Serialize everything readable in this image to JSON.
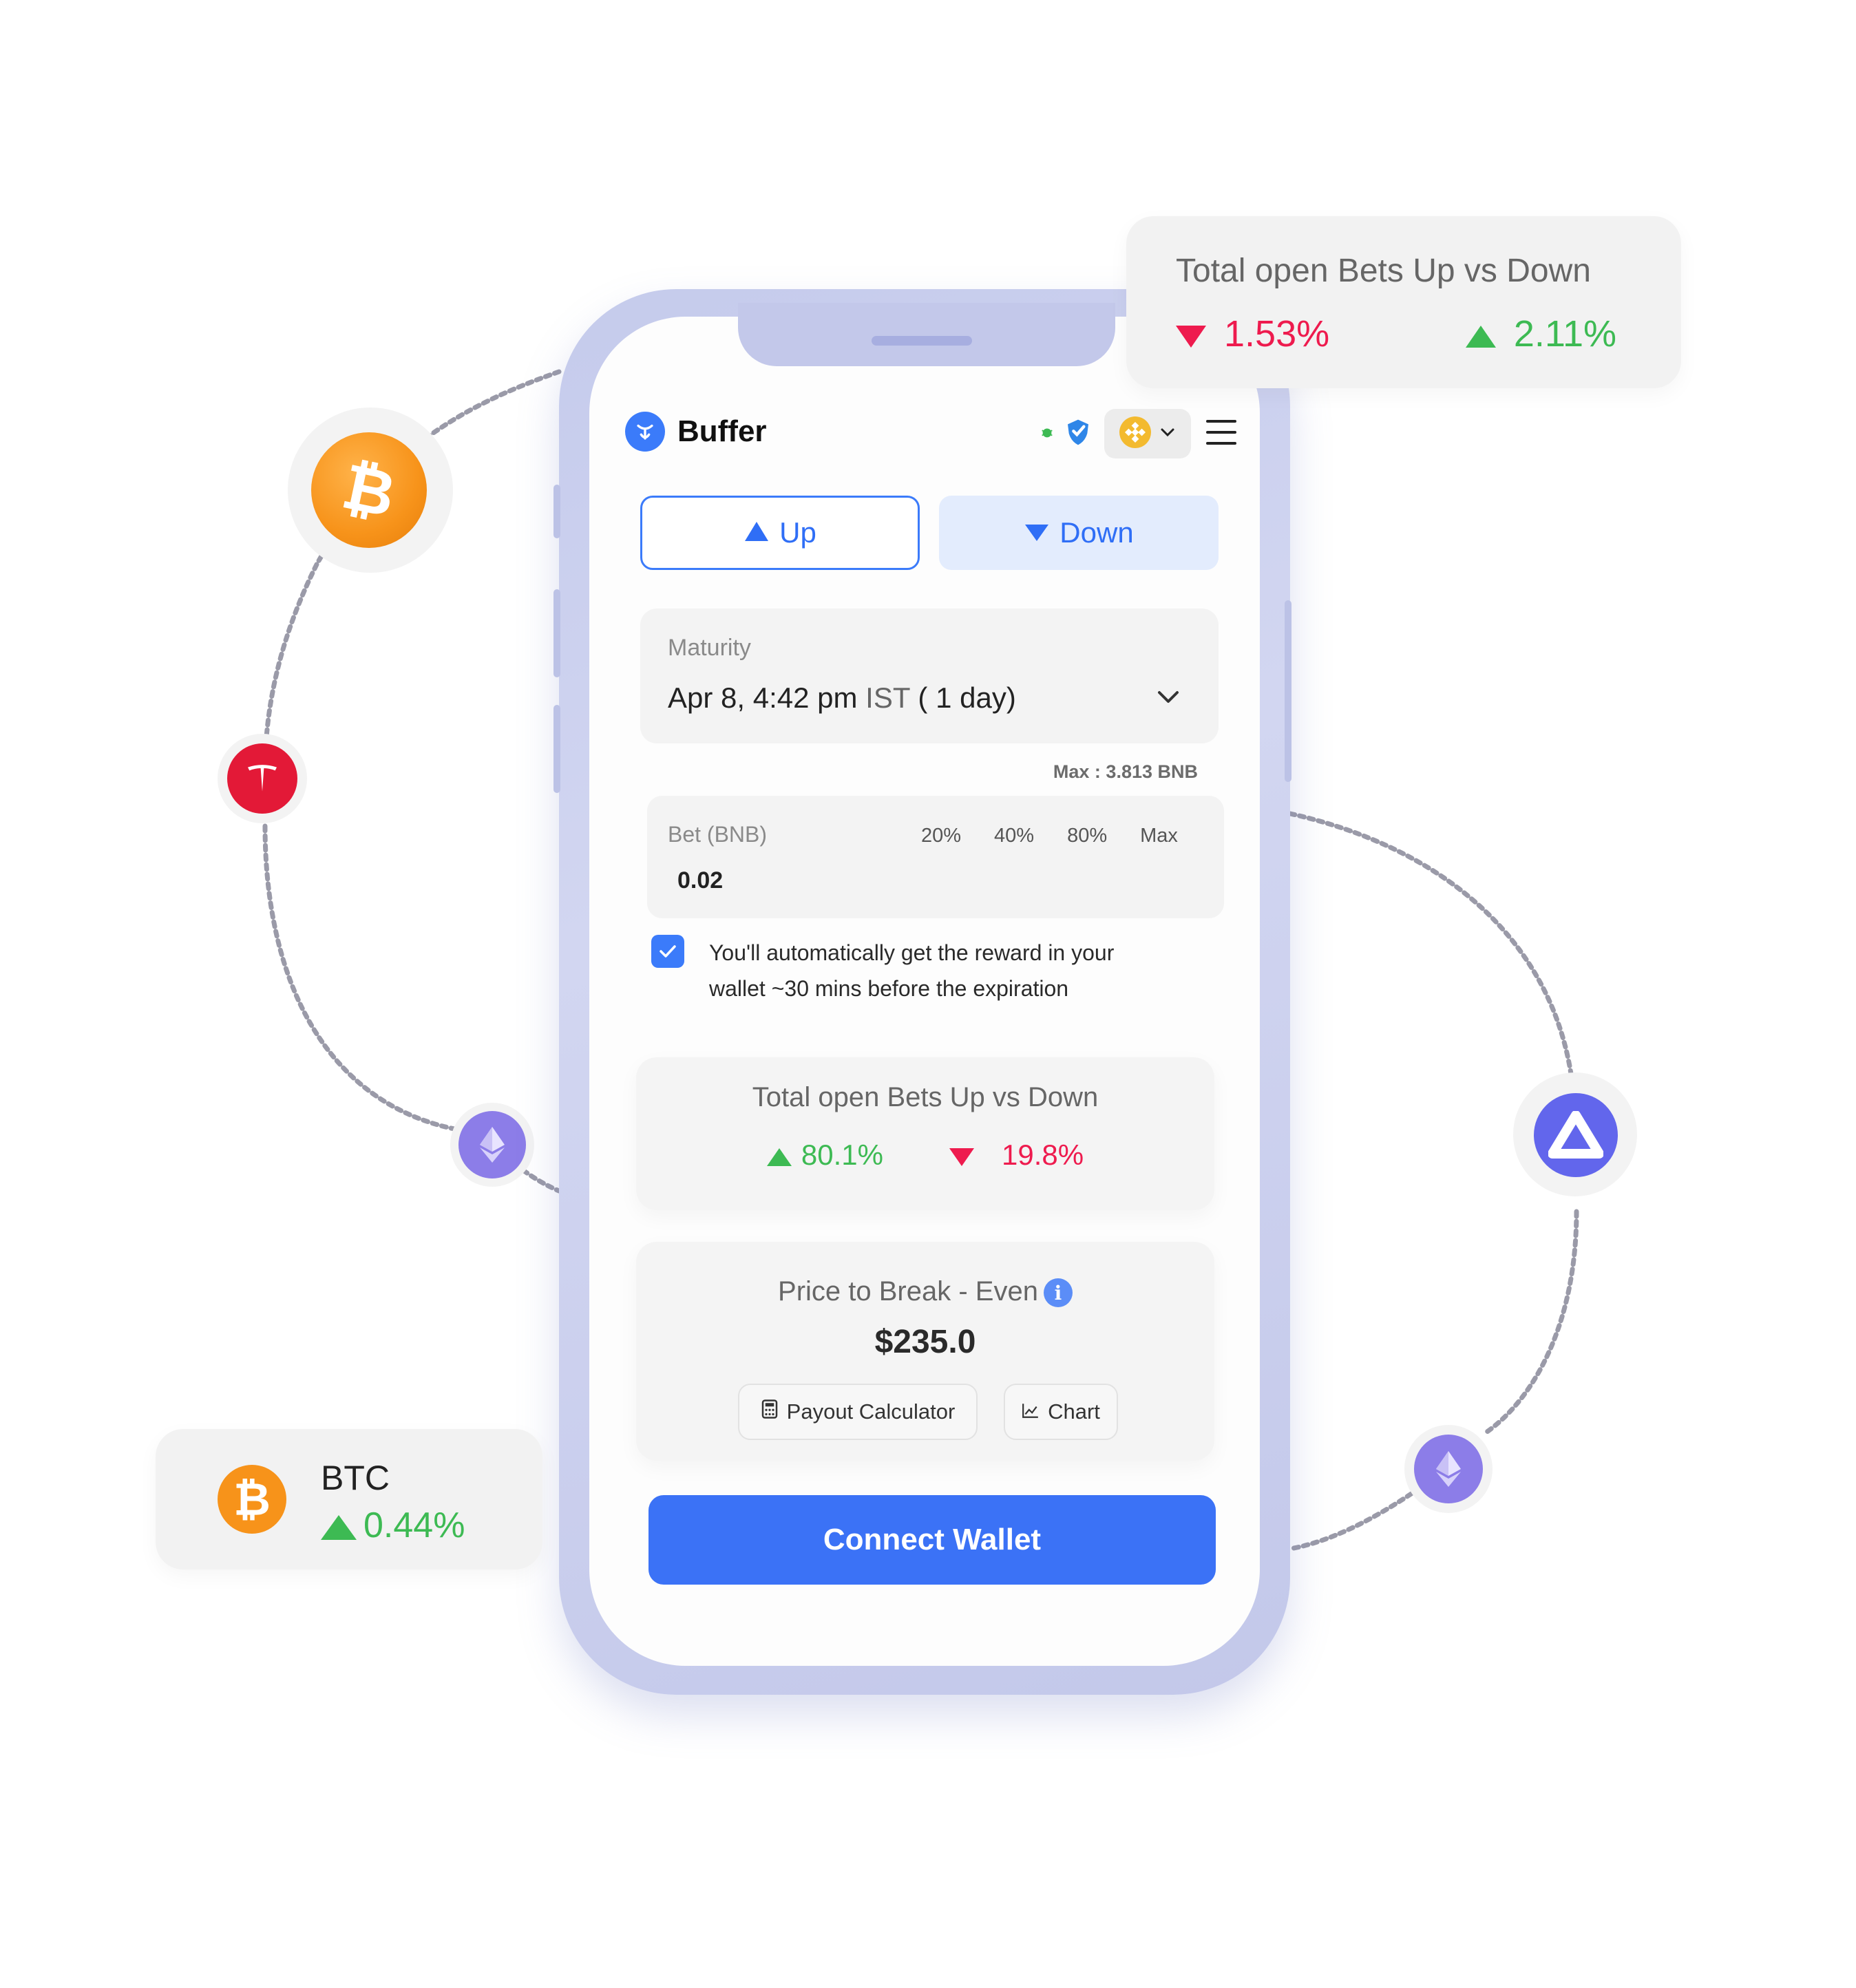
{
  "app": {
    "brand": "Buffer"
  },
  "toggle": {
    "up_label": "Up",
    "down_label": "Down"
  },
  "maturity": {
    "label": "Maturity",
    "date": "Apr 8, 4:42 pm",
    "tz": "IST",
    "duration": "( 1 day)"
  },
  "bet": {
    "max_note": "Max : 3.813 BNB",
    "label": "Bet (BNB)",
    "presets": [
      "20%",
      "40%",
      "80%",
      "Max"
    ],
    "value": "0.02"
  },
  "auto_reward": {
    "checked": true,
    "text_line1": "You'll automatically get the reward in your",
    "text_line2": "wallet ~30 mins before the expiration"
  },
  "open_bets": {
    "title": "Total open Bets Up vs Down",
    "up_pct": "80.1%",
    "down_pct": "19.8%"
  },
  "break_even": {
    "title": "Price to Break - Even",
    "info": "i",
    "price": "$235.0",
    "payout_label": "Payout Calculator",
    "chart_label": "Chart"
  },
  "connect_label": "Connect Wallet",
  "float_top": {
    "title": "Total open Bets Up vs Down",
    "down_pct": "1.53%",
    "up_pct": "2.11%"
  },
  "float_btc": {
    "symbol": "BTC",
    "change": "0.44%"
  },
  "colors": {
    "accent": "#3b7bfa",
    "up": "#3dba53",
    "down": "#ee1b4e",
    "btc": "#f7931a",
    "tesla": "#e31937",
    "eth": "#8c7de8"
  }
}
